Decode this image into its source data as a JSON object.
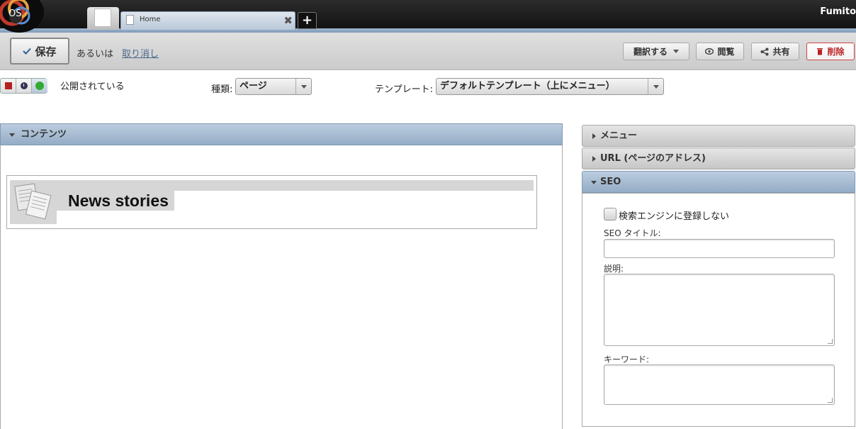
{
  "header": {
    "logo_text": "OS",
    "tabs": [
      {
        "label": "Home"
      }
    ],
    "add_tab_symbol": "+",
    "user_name": "Fumito"
  },
  "toolbar": {
    "save_label": "保存",
    "or_text": "あるいは",
    "cancel_label": "取り消し",
    "translate_label": "翻訳する",
    "view_label": "閲覧",
    "share_label": "共有",
    "delete_label": "削除"
  },
  "status": {
    "published_text": "公開されている",
    "type_label": "種類:",
    "type_value": "ページ",
    "template_label": "テンプレート:",
    "template_value": "デフォルトテンプレート（上にメニュー）"
  },
  "content": {
    "panel_title": "コンテンツ",
    "block_title": "News stories"
  },
  "sidebar": {
    "menu_title": "メニュー",
    "url_title": "URL (ページのアドレス)",
    "seo_title": "SEO",
    "seo": {
      "no_index_label": "検索エンジンに登録しない",
      "no_index_checked": false,
      "title_label": "SEO タイトル:",
      "title_value": "",
      "description_label": "説明:",
      "description_value": "",
      "keywords_label": "キーワード:",
      "keywords_value": ""
    }
  },
  "colors": {
    "header_blue": "#94acc6",
    "delete_red": "#b22222",
    "status_green": "#33aa33",
    "status_red": "#b52020"
  }
}
